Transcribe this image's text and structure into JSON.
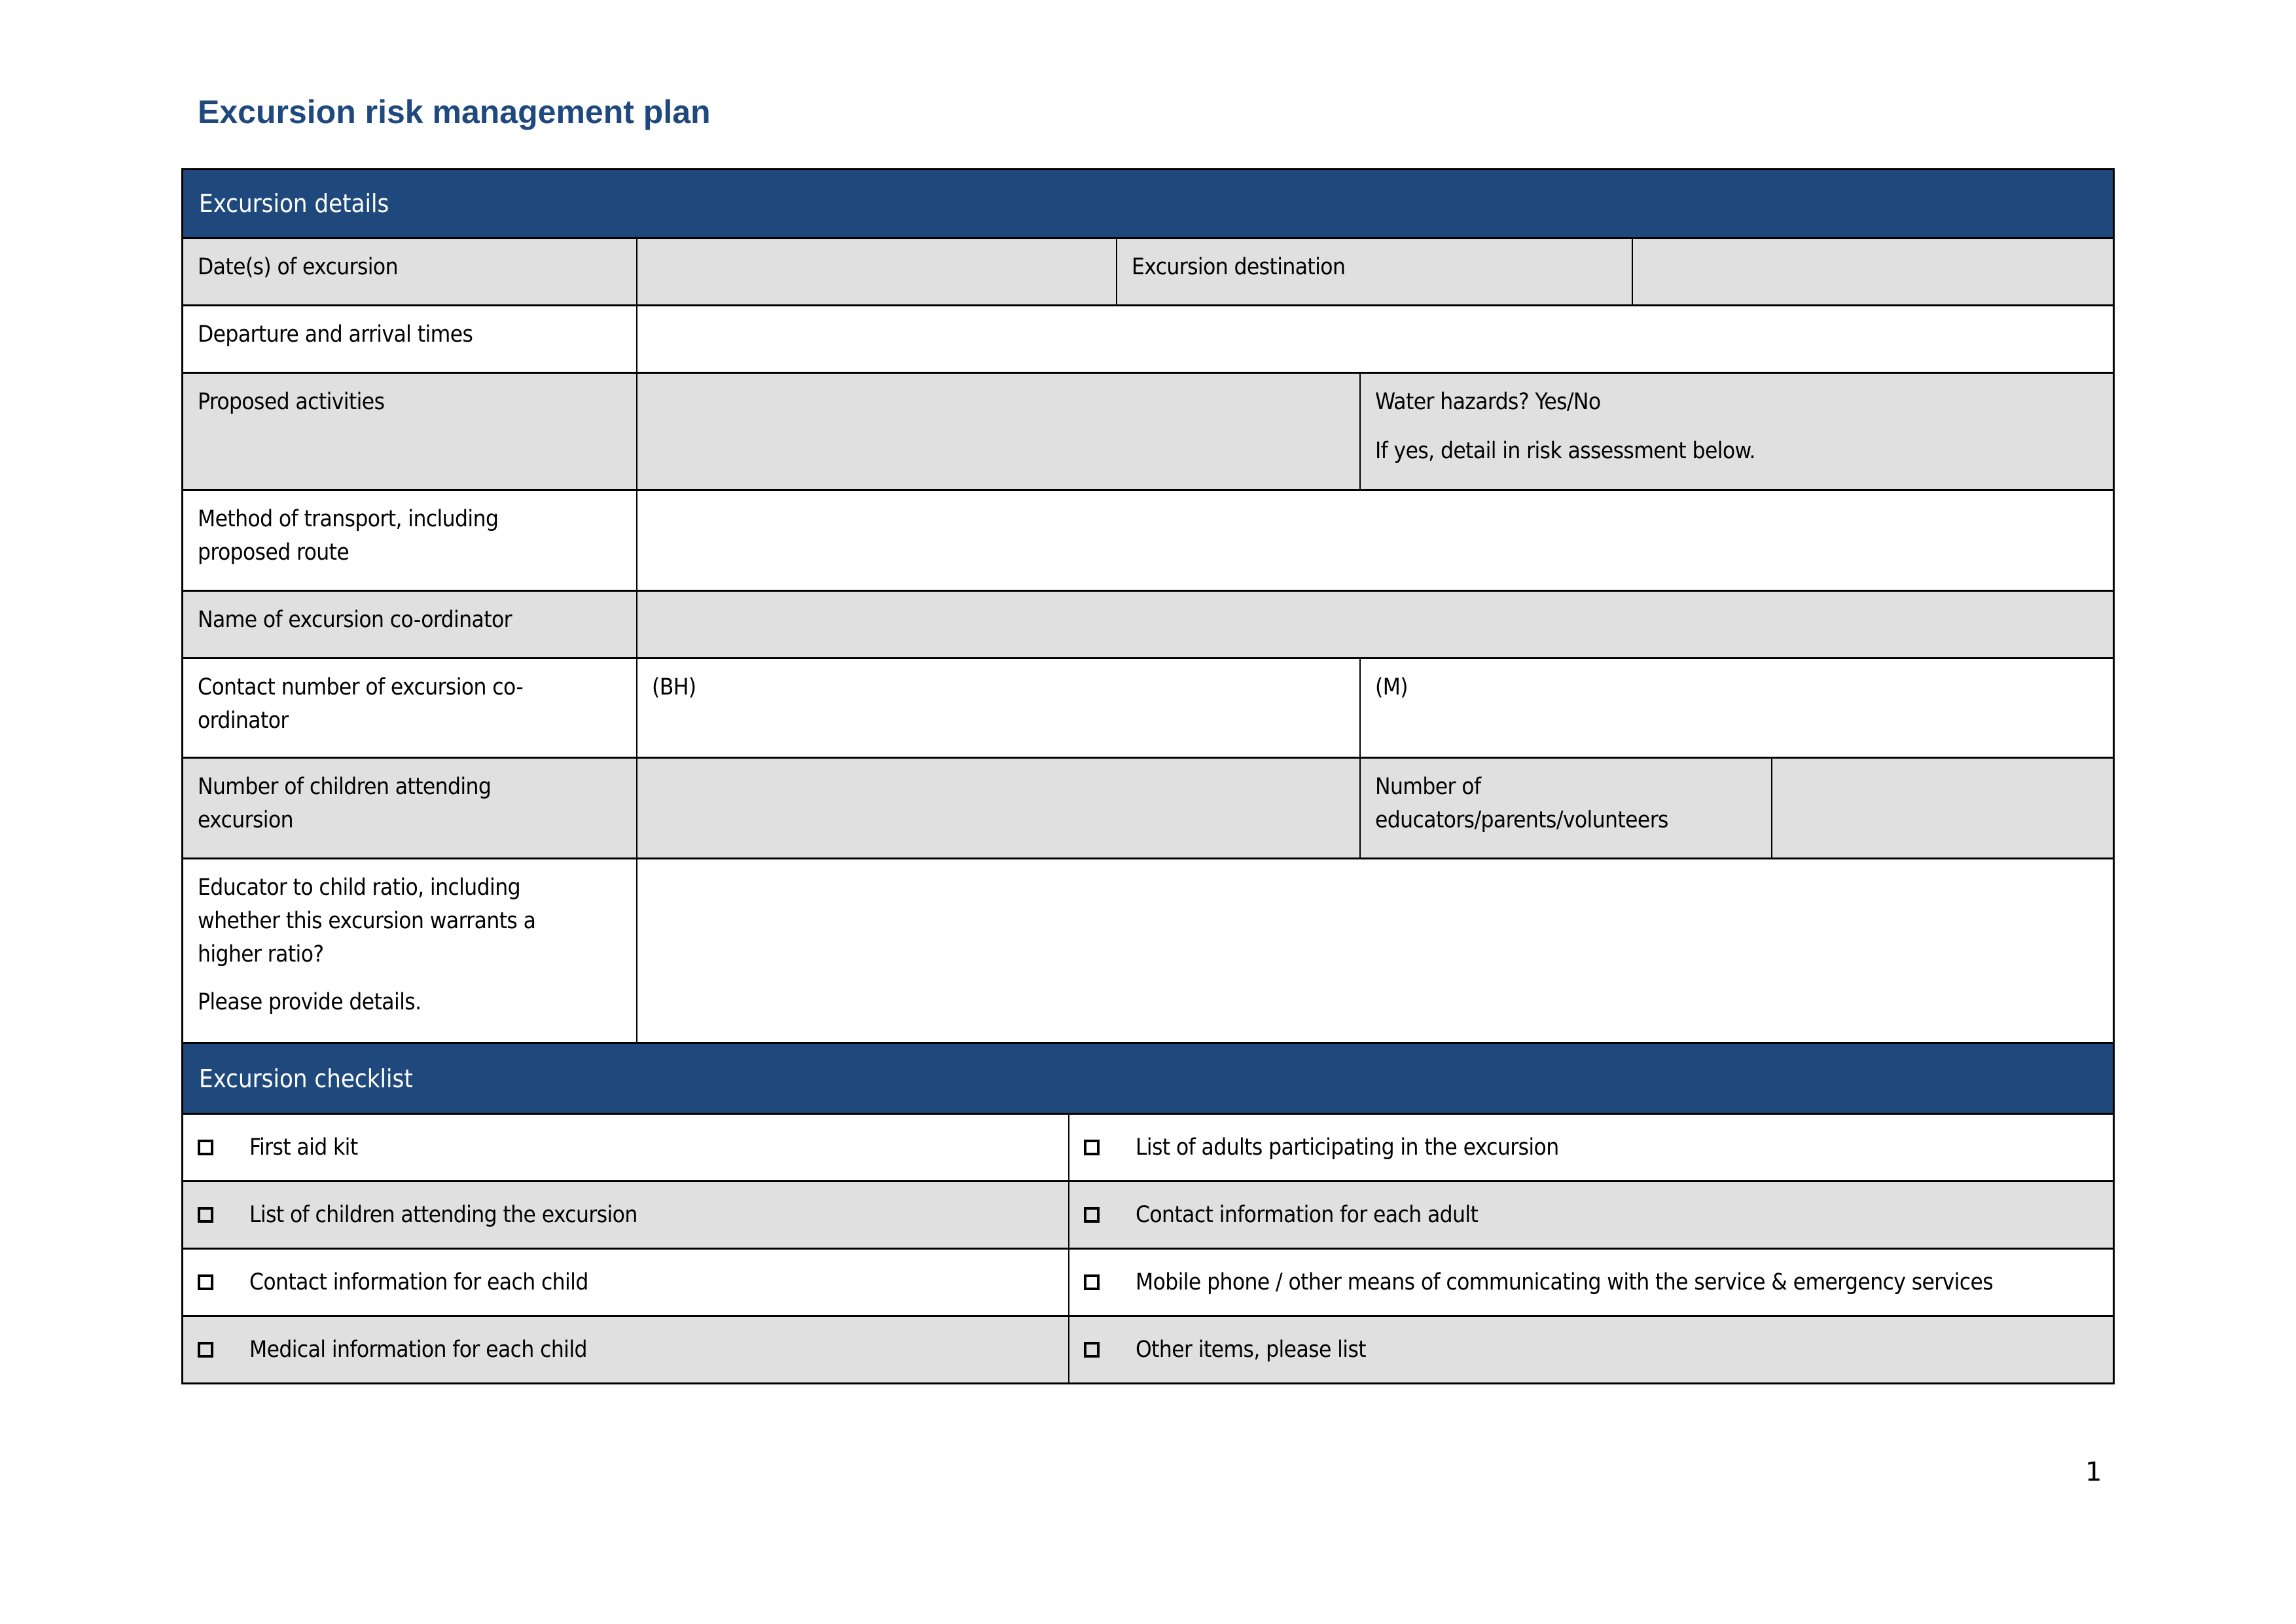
{
  "document": {
    "title": "Excursion risk management plan",
    "page_number": "1",
    "colors": {
      "accent": "#1f497d",
      "row_shade": "#e0e0e0"
    }
  },
  "details": {
    "section_title": "Excursion details",
    "dates_label": "Date(s) of excursion",
    "dates_value": "",
    "destination_label": "Excursion destination",
    "destination_value": "",
    "times_label": "Departure and arrival times",
    "times_value": "",
    "activities_label": "Proposed activities",
    "activities_value": "",
    "water_hazards_label": "Water hazards?   Yes/No",
    "water_hazards_note": "If yes, detail in risk assessment below.",
    "transport_label_line1": "Method of transport, including",
    "transport_label_line2": "proposed route",
    "transport_value": "",
    "coordinator_label": "Name of excursion co-ordinator",
    "coordinator_value": "",
    "contact_label_line1": "Contact number of excursion co-",
    "contact_label_line2": "ordinator",
    "contact_bh_label": "(BH)",
    "contact_m_label": "(M)",
    "children_label_line1": "Number of children attending",
    "children_label_line2": "excursion",
    "children_value": "",
    "adults_label_line1": "Number of",
    "adults_label_line2": "educators/parents/volunteers",
    "adults_value": "",
    "ratio_label_line1": "Educator to child ratio, including",
    "ratio_label_line2": "whether this excursion warrants a",
    "ratio_label_line3": "higher ratio?",
    "ratio_label_line4": "Please provide details.",
    "ratio_value": ""
  },
  "checklist": {
    "section_title": "Excursion checklist",
    "items": [
      {
        "label": "First aid kit",
        "checked": false
      },
      {
        "label": "List of adults participating in the excursion",
        "checked": false
      },
      {
        "label": "List of children attending the excursion",
        "checked": false
      },
      {
        "label": "Contact information for each adult",
        "checked": false
      },
      {
        "label": "Contact information for each child",
        "checked": false
      },
      {
        "label": "Mobile phone / other means of communicating with the service & emergency services",
        "checked": false
      },
      {
        "label": "Medical information for each child",
        "checked": false
      },
      {
        "label": "Other items, please list",
        "checked": false
      }
    ]
  }
}
